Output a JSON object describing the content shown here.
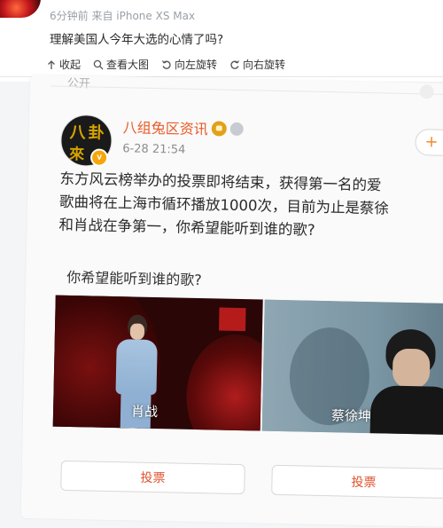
{
  "meta": {
    "time_ago": "6分钟前",
    "source": "来自 iPhone XS Max"
  },
  "question": "理解美国人今年大选的心情了吗?",
  "toolbar": {
    "collapse_label": "收起",
    "view_large_label": "查看大图",
    "rotate_left_label": "向左旋转",
    "rotate_right_label": "向右旋转"
  },
  "screenshot_post": {
    "partial_text": "公开",
    "author": "八组兔区资讯",
    "avatar_text_line1": "八卦",
    "avatar_text_line2": "來",
    "verified_badge": "v",
    "time": "6-28 21:54",
    "follow_label": "+",
    "body_lines": [
      "东方风云榜举办的投票即将结束，获得第一名的爱",
      "歌曲将在上海市循环播放1000次，目前为止是蔡徐",
      "和肖战在争第一，你希望能听到谁的歌?"
    ],
    "vote_question": "你希望能听到谁的歌?",
    "options": [
      {
        "label": "肖战",
        "button": "投票"
      },
      {
        "label": "蔡徐坤",
        "button": "投票"
      }
    ]
  },
  "colors": {
    "accent": "#e85b27",
    "vote_text": "#e0532d"
  }
}
